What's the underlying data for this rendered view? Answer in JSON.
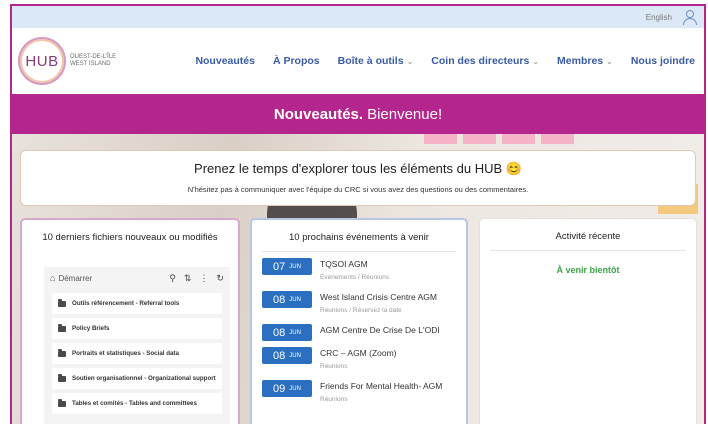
{
  "topbar": {
    "language": "English",
    "user_icon": "user-icon"
  },
  "logo": {
    "mark": "HUB",
    "line1": "Ouest-de-l'Île",
    "line2": "West Island"
  },
  "nav": [
    {
      "label": "Nouveautés",
      "dropdown": false
    },
    {
      "label": "À Propos",
      "dropdown": false
    },
    {
      "label": "Boîte à outils",
      "dropdown": true
    },
    {
      "label": "Coin des directeurs",
      "dropdown": true
    },
    {
      "label": "Membres",
      "dropdown": true
    },
    {
      "label": "Nous joindre",
      "dropdown": false
    }
  ],
  "banner": {
    "bold": "Nouveautés.",
    "rest": "Bienvenue!"
  },
  "explore": {
    "heading": "Prenez le temps d'explorer tous les éléments du HUB 😊",
    "subtext": "N'hésitez pas à communiquer avec l'équipe du CRC si vous avez des questions ou des commentaires."
  },
  "files_panel": {
    "title": "10 derniers fichiers nouveaux ou modifiés",
    "breadcrumb": "Démarrer",
    "folders": [
      "Outils référencement - Referral tools",
      "Policy Briefs",
      "Portraits et statistiques - Social data",
      "Soutien organisationnel - Organizational support",
      "Tables et comités - Tables and committees"
    ]
  },
  "events_panel": {
    "title": "10 prochains événements à venir",
    "events": [
      {
        "day": "07",
        "month": "JUN",
        "title": "TQSOI AGM",
        "category": "Événements / Réunions"
      },
      {
        "day": "08",
        "month": "JUN",
        "title": "West Island Crisis Centre AGM",
        "category": "Réunions / Réservez la date"
      },
      {
        "day": "08",
        "month": "JUN",
        "title": "AGM Centre De Crise De L'ODI",
        "category": ""
      },
      {
        "day": "08",
        "month": "JUN",
        "title": "CRC – AGM (Zoom)",
        "category": "Réunions"
      },
      {
        "day": "09",
        "month": "JUN",
        "title": "Friends For Mental Health- AGM",
        "category": "Réunions"
      }
    ]
  },
  "activity_panel": {
    "title": "Activité récente",
    "status": "À venir bientôt"
  },
  "colors": {
    "brand": "#b5258e",
    "nav_text": "#3a5aa5",
    "date_badge": "#2a6fc0",
    "status_green": "#3ca547",
    "topbar_bg": "#dbe8f6"
  }
}
